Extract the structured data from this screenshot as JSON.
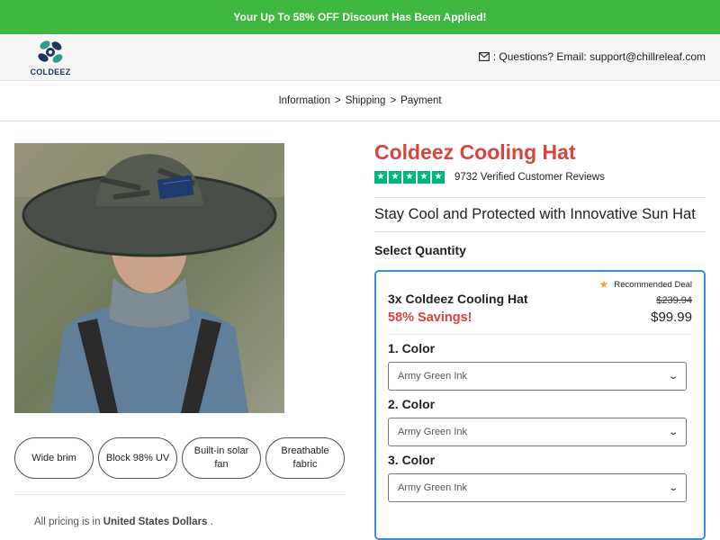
{
  "banner": {
    "text": "Your Up To 58% OFF Discount Has Been Applied!"
  },
  "header": {
    "logo_text": "COLDEEZ",
    "contact_icon": "envelope-icon",
    "contact_text": ": Questions? Email: support@chillreleaf.com"
  },
  "breadcrumb": {
    "steps": [
      "Information",
      "Shipping",
      "Payment"
    ],
    "separator": ">"
  },
  "features": [
    "Wide brim",
    "Block 98% UV",
    "Built-in solar fan",
    "Breathable fabric"
  ],
  "pricing_note": {
    "prefix": "All pricing is in",
    "currency": "United States Dollars",
    "suffix": "."
  },
  "product": {
    "title": "Coldeez Cooling Hat",
    "rating_stars": 5,
    "reviews": "9732 Verified Customer Reviews",
    "subtitle": "Stay Cool and Protected with Innovative Sun Hat",
    "select_quantity": "Select Quantity"
  },
  "deal": {
    "badge": "Recommended Deal",
    "name": "3x Coldeez Cooling Hat",
    "old_price": "$239.94",
    "savings": "58% Savings!",
    "price": "$99.99",
    "colors": [
      {
        "label": "1. Color",
        "value": "Army Green Ink"
      },
      {
        "label": "2. Color",
        "value": "Army Green Ink"
      },
      {
        "label": "3. Color",
        "value": "Army Green Ink"
      }
    ]
  },
  "colors": {
    "banner": "#3fb83f",
    "title": "#d9443c",
    "trustpilot": "#00b67a",
    "deal_border": "#3a8fd6"
  }
}
